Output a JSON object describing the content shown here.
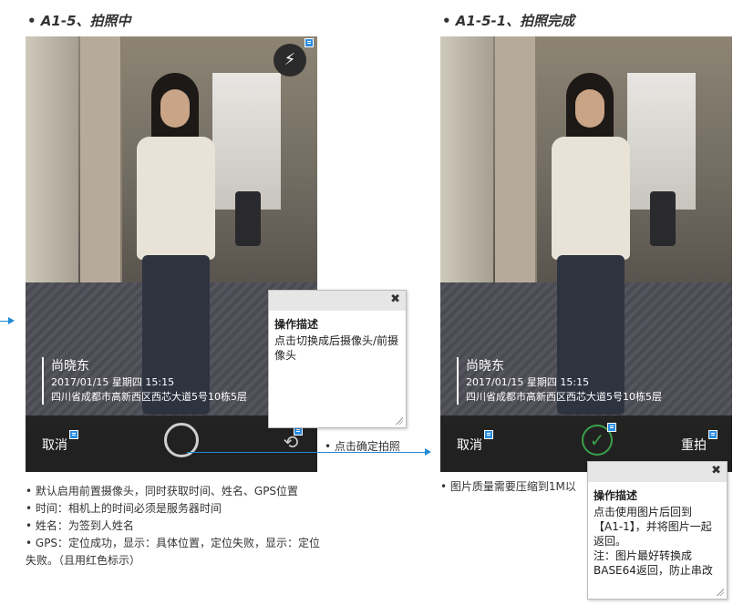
{
  "left": {
    "title": "• A1-5、拍照中",
    "caption": {
      "name": "尚晓东",
      "datetime": "2017/01/15 星期四    15:15",
      "address": "四川省成都市高新西区西芯大道5号10栋5层"
    },
    "cancel_label": "取消",
    "flash_icon": "flash-icon",
    "switch_icon": "camera-switch-icon",
    "note": {
      "title": "操作描述",
      "body": "点击切换成后摄像头/前摄像头"
    },
    "shutter_hint": "• 点击确定拍照",
    "bullets": [
      "• 默认启用前置摄像头，同时获取时间、姓名、GPS位置",
      "• 时间：相机上的时间必须是服务器时间",
      "• 姓名：为签到人姓名",
      "• GPS：定位成功，显示：具体位置，定位失败，显示：定位",
      "失败。（且用红色标示）"
    ]
  },
  "right": {
    "title": "• A1-5-1、拍照完成",
    "caption": {
      "name": "尚晓东",
      "datetime": "2017/01/15 星期四    15:15",
      "address": "四川省成都市高新西区西芯大道5号10栋5层"
    },
    "cancel_label": "取消",
    "retake_label": "重拍",
    "confirm_icon": "check-icon",
    "bullet": "• 图片质量需要压缩到1M以",
    "note": {
      "title": "操作描述",
      "body": "点击使用图片后回到\n【A1-1】，并将图片一起\n返回。\n注：图片最好转换成\nBASE64返回，防止串改"
    }
  },
  "colors": {
    "accent": "#1f8ad2",
    "badge": "#2b8de0",
    "confirm": "#3aa04a"
  }
}
